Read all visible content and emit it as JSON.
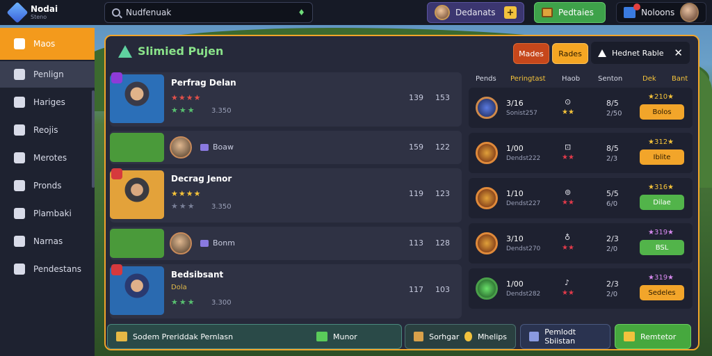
{
  "app": {
    "title": "Nodai",
    "subtitle": "Steno"
  },
  "search": {
    "value": "Nudfenuak"
  },
  "topbar": {
    "user_label": "Dedanats",
    "rewards_label": "Pedtaies",
    "notifications_label": "Noloons"
  },
  "sidebar": {
    "items": [
      {
        "label": "Maos"
      },
      {
        "label": "Penlign"
      },
      {
        "label": "Hariges"
      },
      {
        "label": "Reojis"
      },
      {
        "label": "Merotes"
      },
      {
        "label": "Pronds"
      },
      {
        "label": "Plambaki"
      },
      {
        "label": "Narnas"
      },
      {
        "label": "Pendestans"
      }
    ]
  },
  "panel": {
    "title": "Slimied Pujen",
    "btn_red": "Mades",
    "btn_orange": "Rades",
    "chip_label": "Hednet Rable"
  },
  "list": {
    "rows": [
      {
        "name": "Perfrag Delan",
        "val": "3.350",
        "c1": "139",
        "c2": "153"
      },
      {
        "label": "Boaw",
        "c1": "159",
        "c2": "122"
      },
      {
        "name": "Decrag Jenor",
        "val": "3.350",
        "c1": "119",
        "c2": "123"
      },
      {
        "label": "Bonm",
        "c1": "113",
        "c2": "128"
      },
      {
        "name": "Bedsibsant",
        "sub": "Dola",
        "val": "3.300",
        "c1": "117",
        "c2": "103"
      }
    ]
  },
  "table": {
    "headers": [
      "Pends",
      "Peringtast",
      "Haob",
      "Senton",
      "Dek",
      "Bant"
    ],
    "rows": [
      {
        "a": "3/16",
        "b": "Sonist257",
        "sym": "⊙",
        "stars": "★★",
        "c": "8/5",
        "d": "2/50",
        "score": "★210★",
        "btn": "Bolos"
      },
      {
        "a": "1/00",
        "b": "Dendst222",
        "sym": "⊡",
        "stars": "★★",
        "c": "8/5",
        "d": "2/3",
        "score": "★312★",
        "btn": "Iblite"
      },
      {
        "a": "1/10",
        "b": "Dendst227",
        "sym": "⊚",
        "stars": "★★",
        "c": "5/5",
        "d": "6/0",
        "score": "★316★",
        "btn": "Dilae"
      },
      {
        "a": "3/10",
        "b": "Dendst270",
        "sym": "♁",
        "stars": "★★",
        "c": "2/3",
        "d": "2/0",
        "score": "★319★",
        "btn": "BSL"
      },
      {
        "a": "1/00",
        "b": "Dendst282",
        "sym": "♪",
        "stars": "★★",
        "c": "2/3",
        "d": "2/0",
        "score": "★319★",
        "btn": "Sedeles"
      }
    ]
  },
  "bottom": {
    "main_label": "Sodem Preriddak Pernlasn",
    "mid_label": "Munor",
    "third_label": "Sorhgar",
    "third_extra": "Mhelips",
    "fourth_label": "Pemlodt Sbiistan",
    "green_label": "Remtetor"
  }
}
